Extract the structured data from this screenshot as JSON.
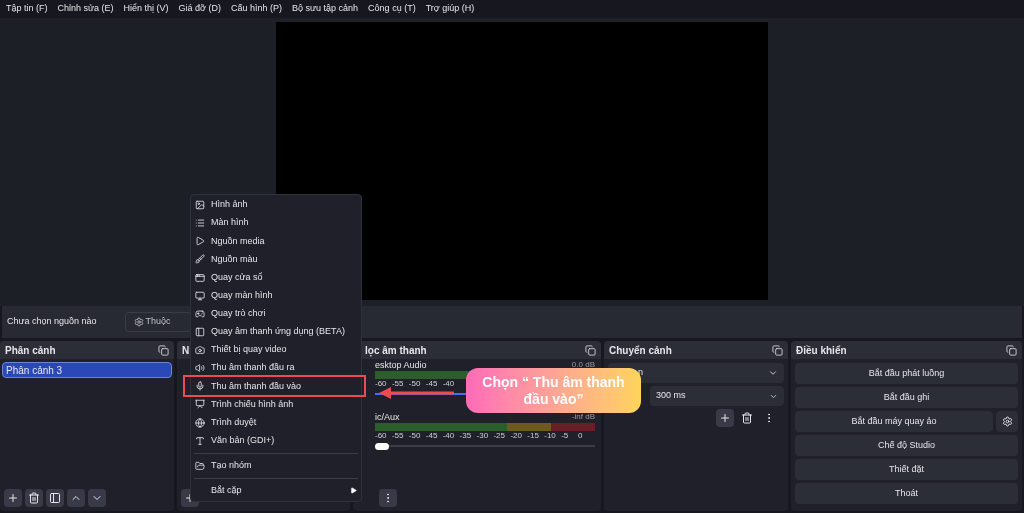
{
  "menu_bar": [
    "Tập tin (F)",
    "Chỉnh sửa (E)",
    "Hiển thị (V)",
    "Giá đỡ (D)",
    "Cấu hình (P)",
    "Bộ sưu tập cảnh",
    "Công cụ (T)",
    "Trợ giúp (H)"
  ],
  "source_toolbar": {
    "status": "Chưa chọn nguồn nào",
    "properties_button": "Thuộc"
  },
  "scenes": {
    "title": "Phân cảnh",
    "items": [
      {
        "label": "Phân cảnh 3",
        "selected": true
      }
    ]
  },
  "sources": {
    "title": "N"
  },
  "mixer": {
    "title": "lọc âm thanh",
    "channels": [
      {
        "name": "esktop Audio",
        "reading": "0.0 dB",
        "level": 1,
        "ticks": [
          "-60",
          "-55",
          "-50",
          "-45",
          "-40"
        ]
      },
      {
        "name": "ic/Aux",
        "reading": "-inf dB",
        "level": 0,
        "ticks": [
          "-60",
          "-55",
          "-50",
          "-45",
          "-40",
          "-35",
          "-30",
          "-25",
          "-20",
          "-15",
          "-10",
          "-5",
          "0"
        ]
      }
    ]
  },
  "transitions": {
    "title": "Chuyển cảnh",
    "type": "n",
    "duration": "300 ms"
  },
  "controls": {
    "title": "Điều khiển",
    "buttons": [
      {
        "label": "Bắt đầu phát luồng",
        "kind": "plain"
      },
      {
        "label": "Bắt đầu ghi",
        "kind": "plain"
      },
      {
        "label": "Bắt đầu máy quay ảo",
        "kind": "settings"
      },
      {
        "label": "Chế độ Studio",
        "kind": "plain"
      },
      {
        "label": "Thiết đặt",
        "kind": "plain"
      },
      {
        "label": "Thoát",
        "kind": "plain"
      }
    ]
  },
  "context_menu": [
    {
      "kind": "item",
      "label": "Hình ảnh",
      "highlighted": false
    },
    {
      "kind": "item",
      "label": "Màn hình",
      "highlighted": false
    },
    {
      "kind": "item",
      "label": "Nguồn media",
      "highlighted": false
    },
    {
      "kind": "item",
      "label": "Nguồn màu",
      "highlighted": false
    },
    {
      "kind": "item",
      "label": "Quay cửa sổ",
      "highlighted": false
    },
    {
      "kind": "item",
      "label": "Quay màn hình",
      "highlighted": false
    },
    {
      "kind": "item",
      "label": "Quay trò chơi",
      "highlighted": false
    },
    {
      "kind": "item",
      "label": "Quay âm thanh ứng dụng (BETA)",
      "highlighted": false
    },
    {
      "kind": "item",
      "label": "Thiết bị quay video",
      "highlighted": false
    },
    {
      "kind": "item",
      "label": "Thu âm thanh đầu ra",
      "highlighted": false
    },
    {
      "kind": "item",
      "label": "Thu âm thanh đầu vào",
      "highlighted": true
    },
    {
      "kind": "item",
      "label": "Trình chiếu hình ảnh",
      "highlighted": false
    },
    {
      "kind": "item",
      "label": "Trình duyệt",
      "highlighted": false
    },
    {
      "kind": "item",
      "label": "Văn bản (GDI+)",
      "highlighted": false
    },
    {
      "kind": "separator"
    },
    {
      "kind": "item",
      "label": "Tạo nhóm",
      "highlighted": false
    },
    {
      "kind": "separator"
    },
    {
      "kind": "submenu",
      "label": "Bắt cặp",
      "highlighted": false
    }
  ],
  "callout": {
    "text": "Chọn “ Thu âm thanh đầu vào”"
  }
}
